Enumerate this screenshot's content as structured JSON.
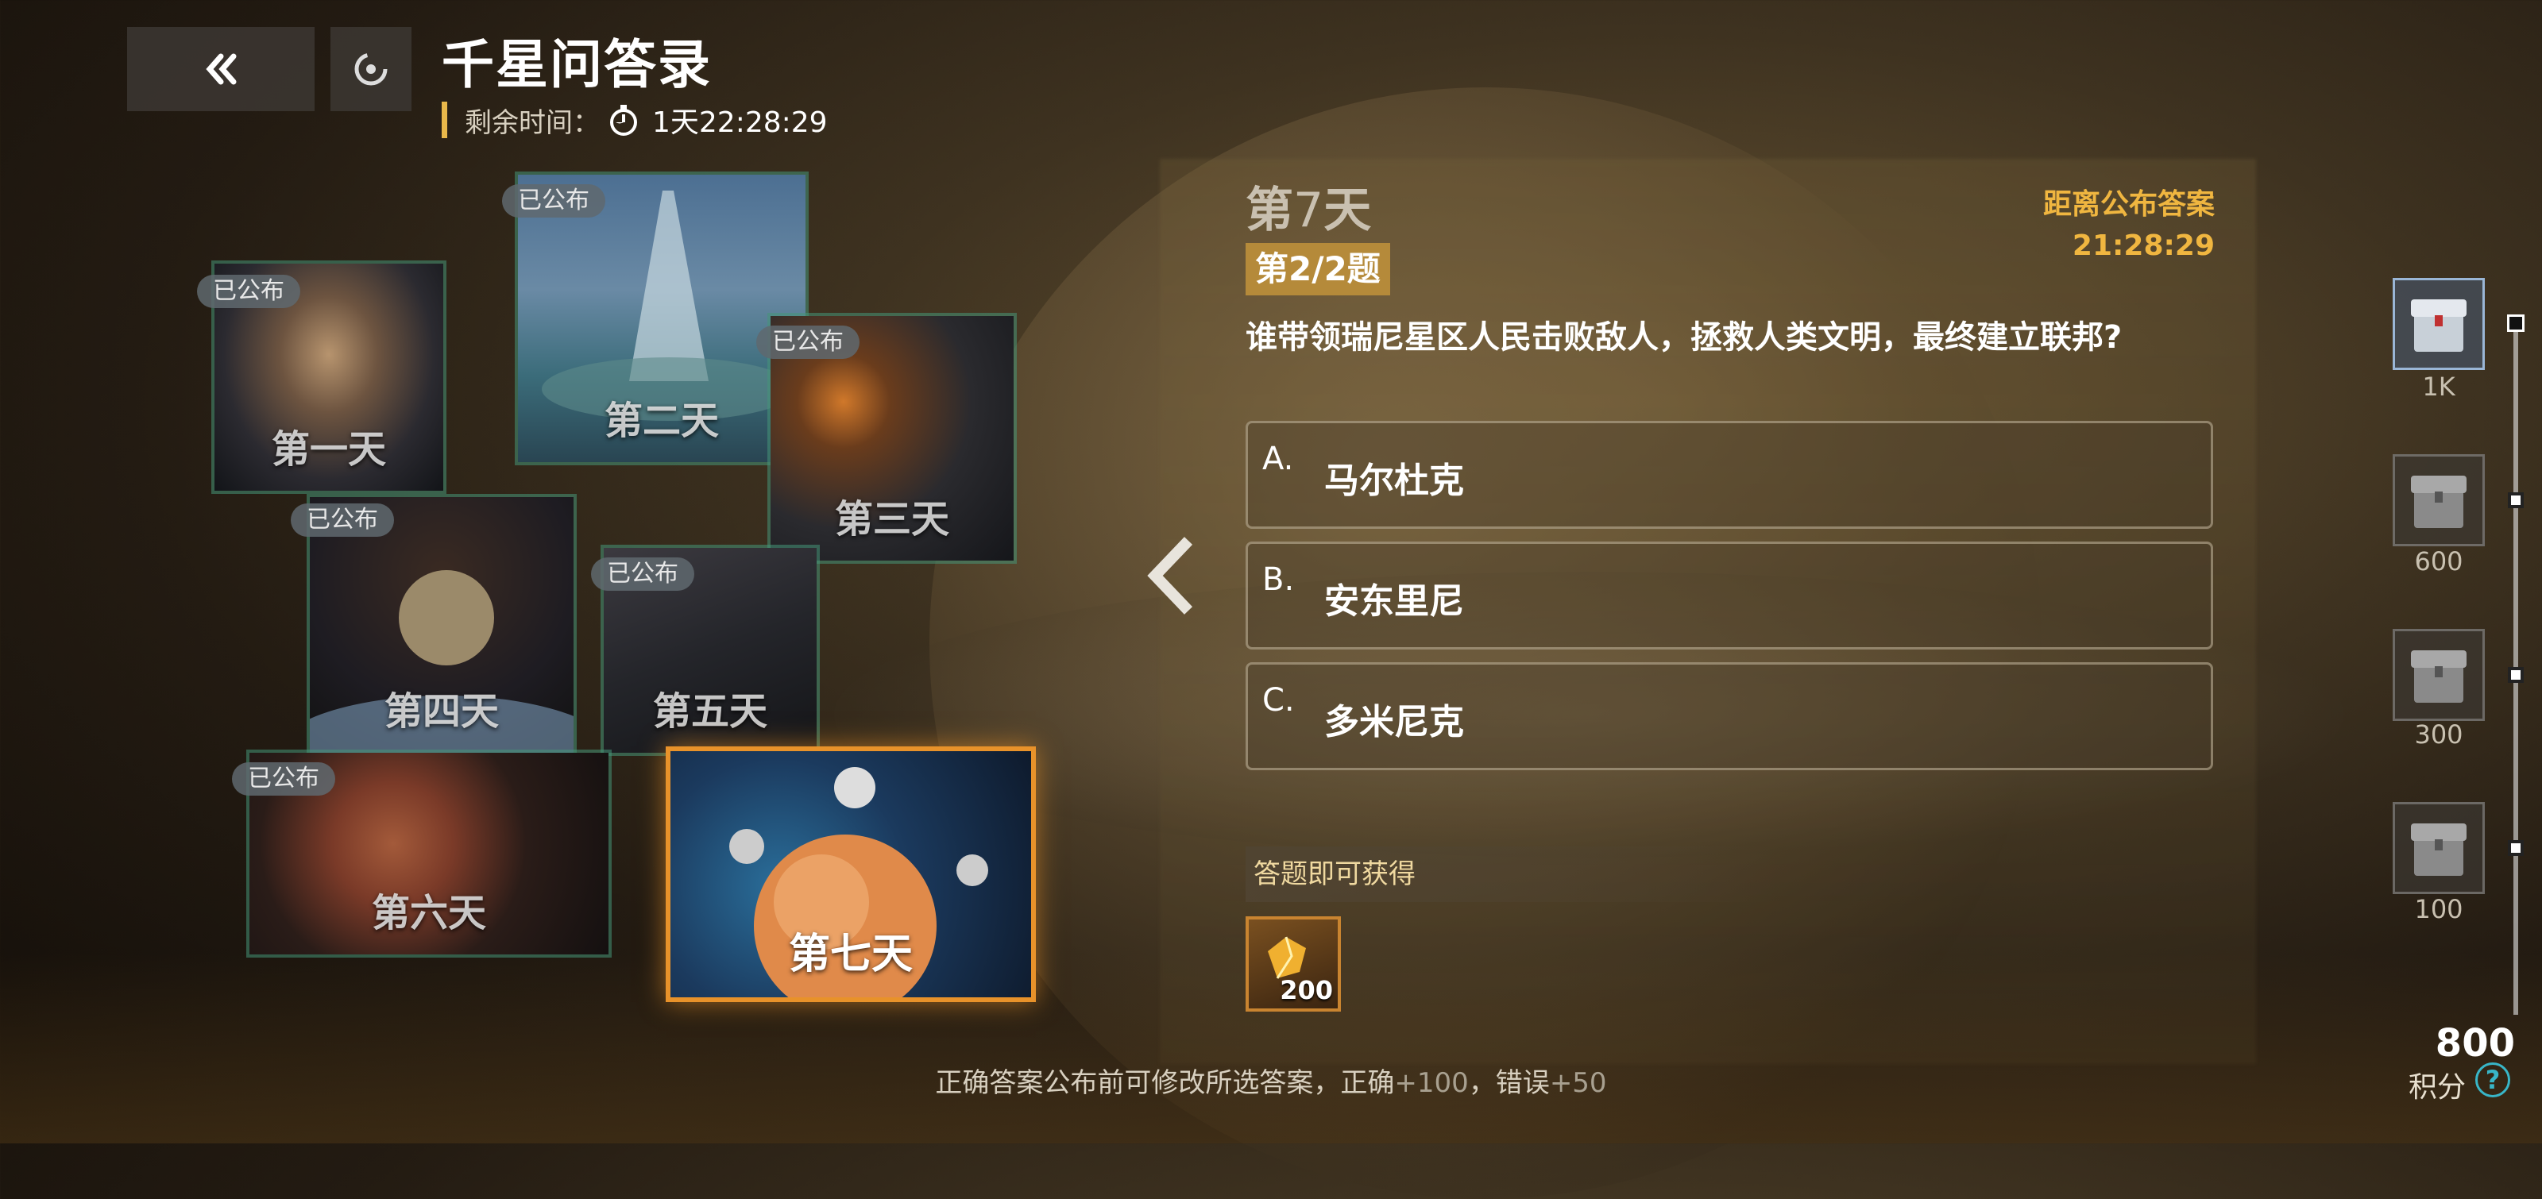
{
  "header": {
    "title": "千星问答录",
    "time_label": "剩余时间：",
    "time_value": "1天22:28:29"
  },
  "days": [
    {
      "label": "第一天",
      "badge": "已公布"
    },
    {
      "label": "第二天",
      "badge": "已公布"
    },
    {
      "label": "第三天",
      "badge": "已公布"
    },
    {
      "label": "第四天",
      "badge": "已公布"
    },
    {
      "label": "第五天",
      "badge": "已公布"
    },
    {
      "label": "第六天",
      "badge": "已公布"
    },
    {
      "label": "第七天",
      "badge": ""
    }
  ],
  "question_panel": {
    "day_prefix": "第",
    "day_number": "7",
    "day_suffix": "天",
    "question_index": "第2/2题",
    "countdown_label": "距离公布答案",
    "countdown_value": "21:28:29",
    "question": "谁带领瑞尼星区人民击败敌人，拯救人类文明，最终建立联邦?",
    "options": [
      {
        "key": "A.",
        "text": "马尔杜克"
      },
      {
        "key": "B.",
        "text": "安东里尼"
      },
      {
        "key": "C.",
        "text": "多米尼克"
      }
    ]
  },
  "reward": {
    "label": "答题即可获得",
    "amount": "200"
  },
  "footer_note": {
    "text1": "正确答案公布前可修改所选答案，正确",
    "plus1": "+100",
    "text2": "，错误",
    "plus2": "+50"
  },
  "progress": {
    "tiers": [
      "1K",
      "600",
      "300",
      "100"
    ],
    "score": "800",
    "score_label": "积分"
  },
  "colors": {
    "accent_gold": "#e9b84a",
    "countdown": "#f0b640",
    "active_border": "#e8922a",
    "card_border": "#46967a"
  }
}
